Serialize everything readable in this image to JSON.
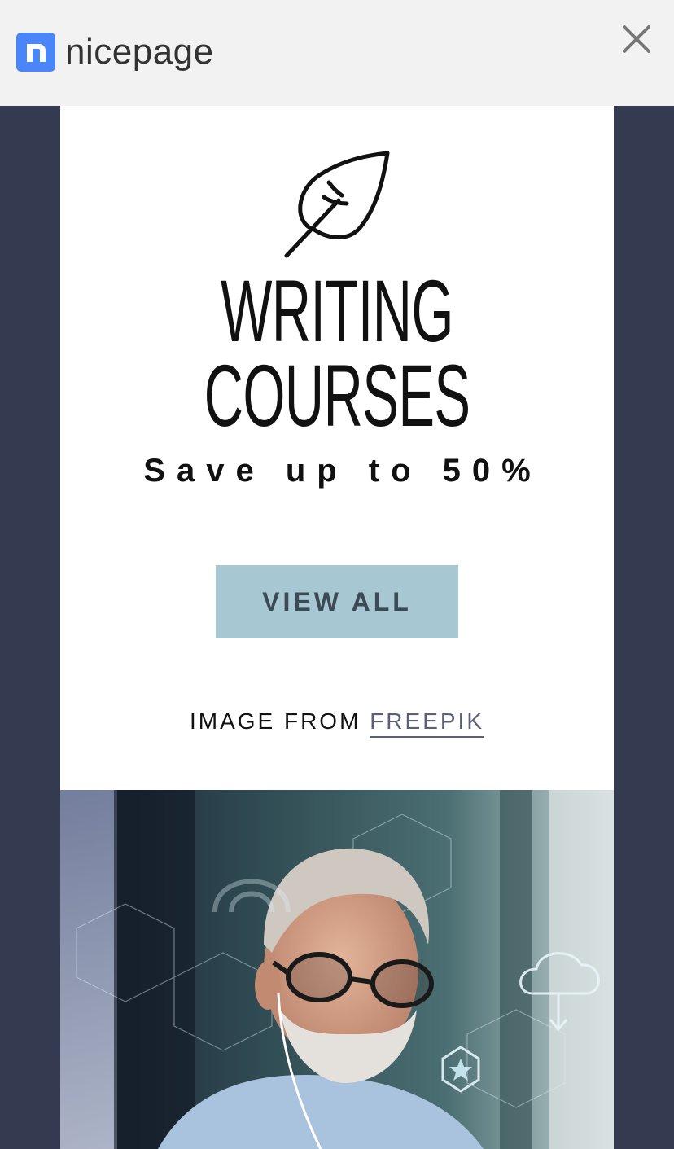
{
  "header": {
    "logo_text": "nicepage",
    "logo_icon": "nicepage-logo-icon",
    "close_icon": "close-icon"
  },
  "hero": {
    "icon": "feather-icon",
    "title_line1": "WRITING",
    "title_line2": "COURSES",
    "subtitle": "Save up to 50%",
    "button_label": "VIEW ALL",
    "credit_prefix": "IMAGE FROM",
    "credit_link": "FREEPIK"
  },
  "colors": {
    "page_bg": "#343b50",
    "topbar_bg": "#f2f2f2",
    "card_bg": "#ffffff",
    "button_bg": "#a7c7d2",
    "button_text": "#3b4a55",
    "link": "#5a6079",
    "logo_blue": "#4a86f7"
  }
}
